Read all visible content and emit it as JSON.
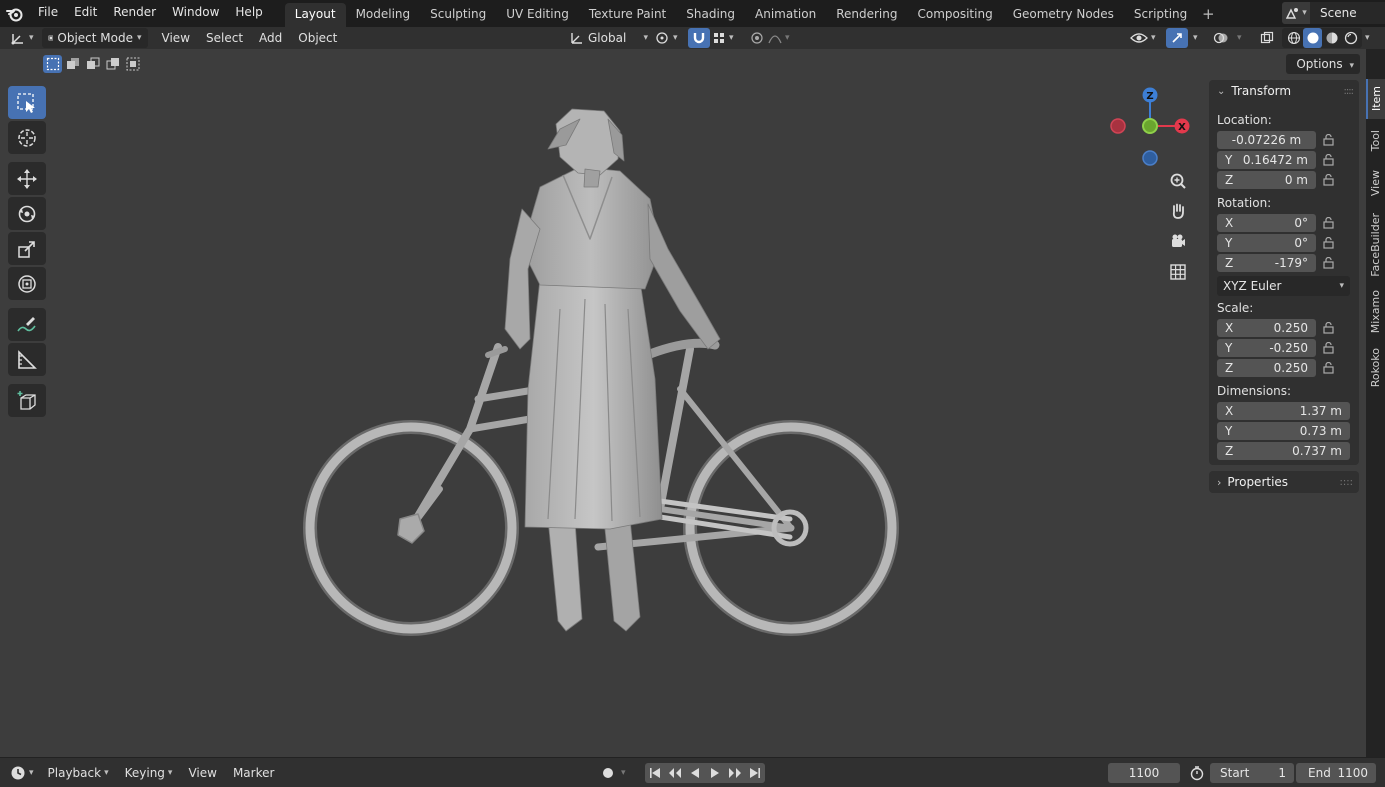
{
  "menu": {
    "file": "File",
    "edit": "Edit",
    "render": "Render",
    "window": "Window",
    "help": "Help"
  },
  "workspaces": [
    {
      "label": "Layout",
      "active": true
    },
    {
      "label": "Modeling"
    },
    {
      "label": "Sculpting"
    },
    {
      "label": "UV Editing"
    },
    {
      "label": "Texture Paint"
    },
    {
      "label": "Shading"
    },
    {
      "label": "Animation"
    },
    {
      "label": "Rendering"
    },
    {
      "label": "Compositing"
    },
    {
      "label": "Geometry Nodes"
    },
    {
      "label": "Scripting"
    }
  ],
  "workspace_add": "+",
  "scene": {
    "name": "Scene"
  },
  "viewport_header": {
    "mode": "Object Mode",
    "view": "View",
    "select": "Select",
    "add": "Add",
    "object": "Object",
    "orientation": "Global"
  },
  "options_label": "Options",
  "npanel": {
    "transform_title": "Transform",
    "location_label": "Location:",
    "location": {
      "x": "-0.07226 m",
      "y_axis": "Y",
      "y": "0.16472 m",
      "z_axis": "Z",
      "z": "0 m"
    },
    "rotation_label": "Rotation:",
    "rotation": {
      "x_axis": "X",
      "x": "0°",
      "y_axis": "Y",
      "y": "0°",
      "z_axis": "Z",
      "z": "-179°"
    },
    "rotation_mode": "XYZ Euler",
    "scale_label": "Scale:",
    "scale": {
      "x_axis": "X",
      "x": "0.250",
      "y_axis": "Y",
      "y": "-0.250",
      "z_axis": "Z",
      "z": "0.250"
    },
    "dimensions_label": "Dimensions:",
    "dimensions": {
      "x_axis": "X",
      "x": "1.37 m",
      "y_axis": "Y",
      "y": "0.73 m",
      "z_axis": "Z",
      "z": "0.737 m"
    },
    "properties_title": "Properties"
  },
  "gizmo": {
    "z": "Z",
    "x": "X"
  },
  "side_tabs": [
    "Item",
    "Tool",
    "View",
    "FaceBuilder",
    "Mixamo",
    "Rokoko"
  ],
  "timeline": {
    "playback": "Playback",
    "keying": "Keying",
    "view": "View",
    "marker": "Marker",
    "current_frame": "1100",
    "start_label": "Start",
    "start": "1",
    "end_label": "End",
    "end": "1100"
  },
  "colors": {
    "accent": "#4772b3",
    "axis_x": "#e2394c",
    "axis_y": "#7cb342",
    "axis_z": "#3d7fd6"
  }
}
